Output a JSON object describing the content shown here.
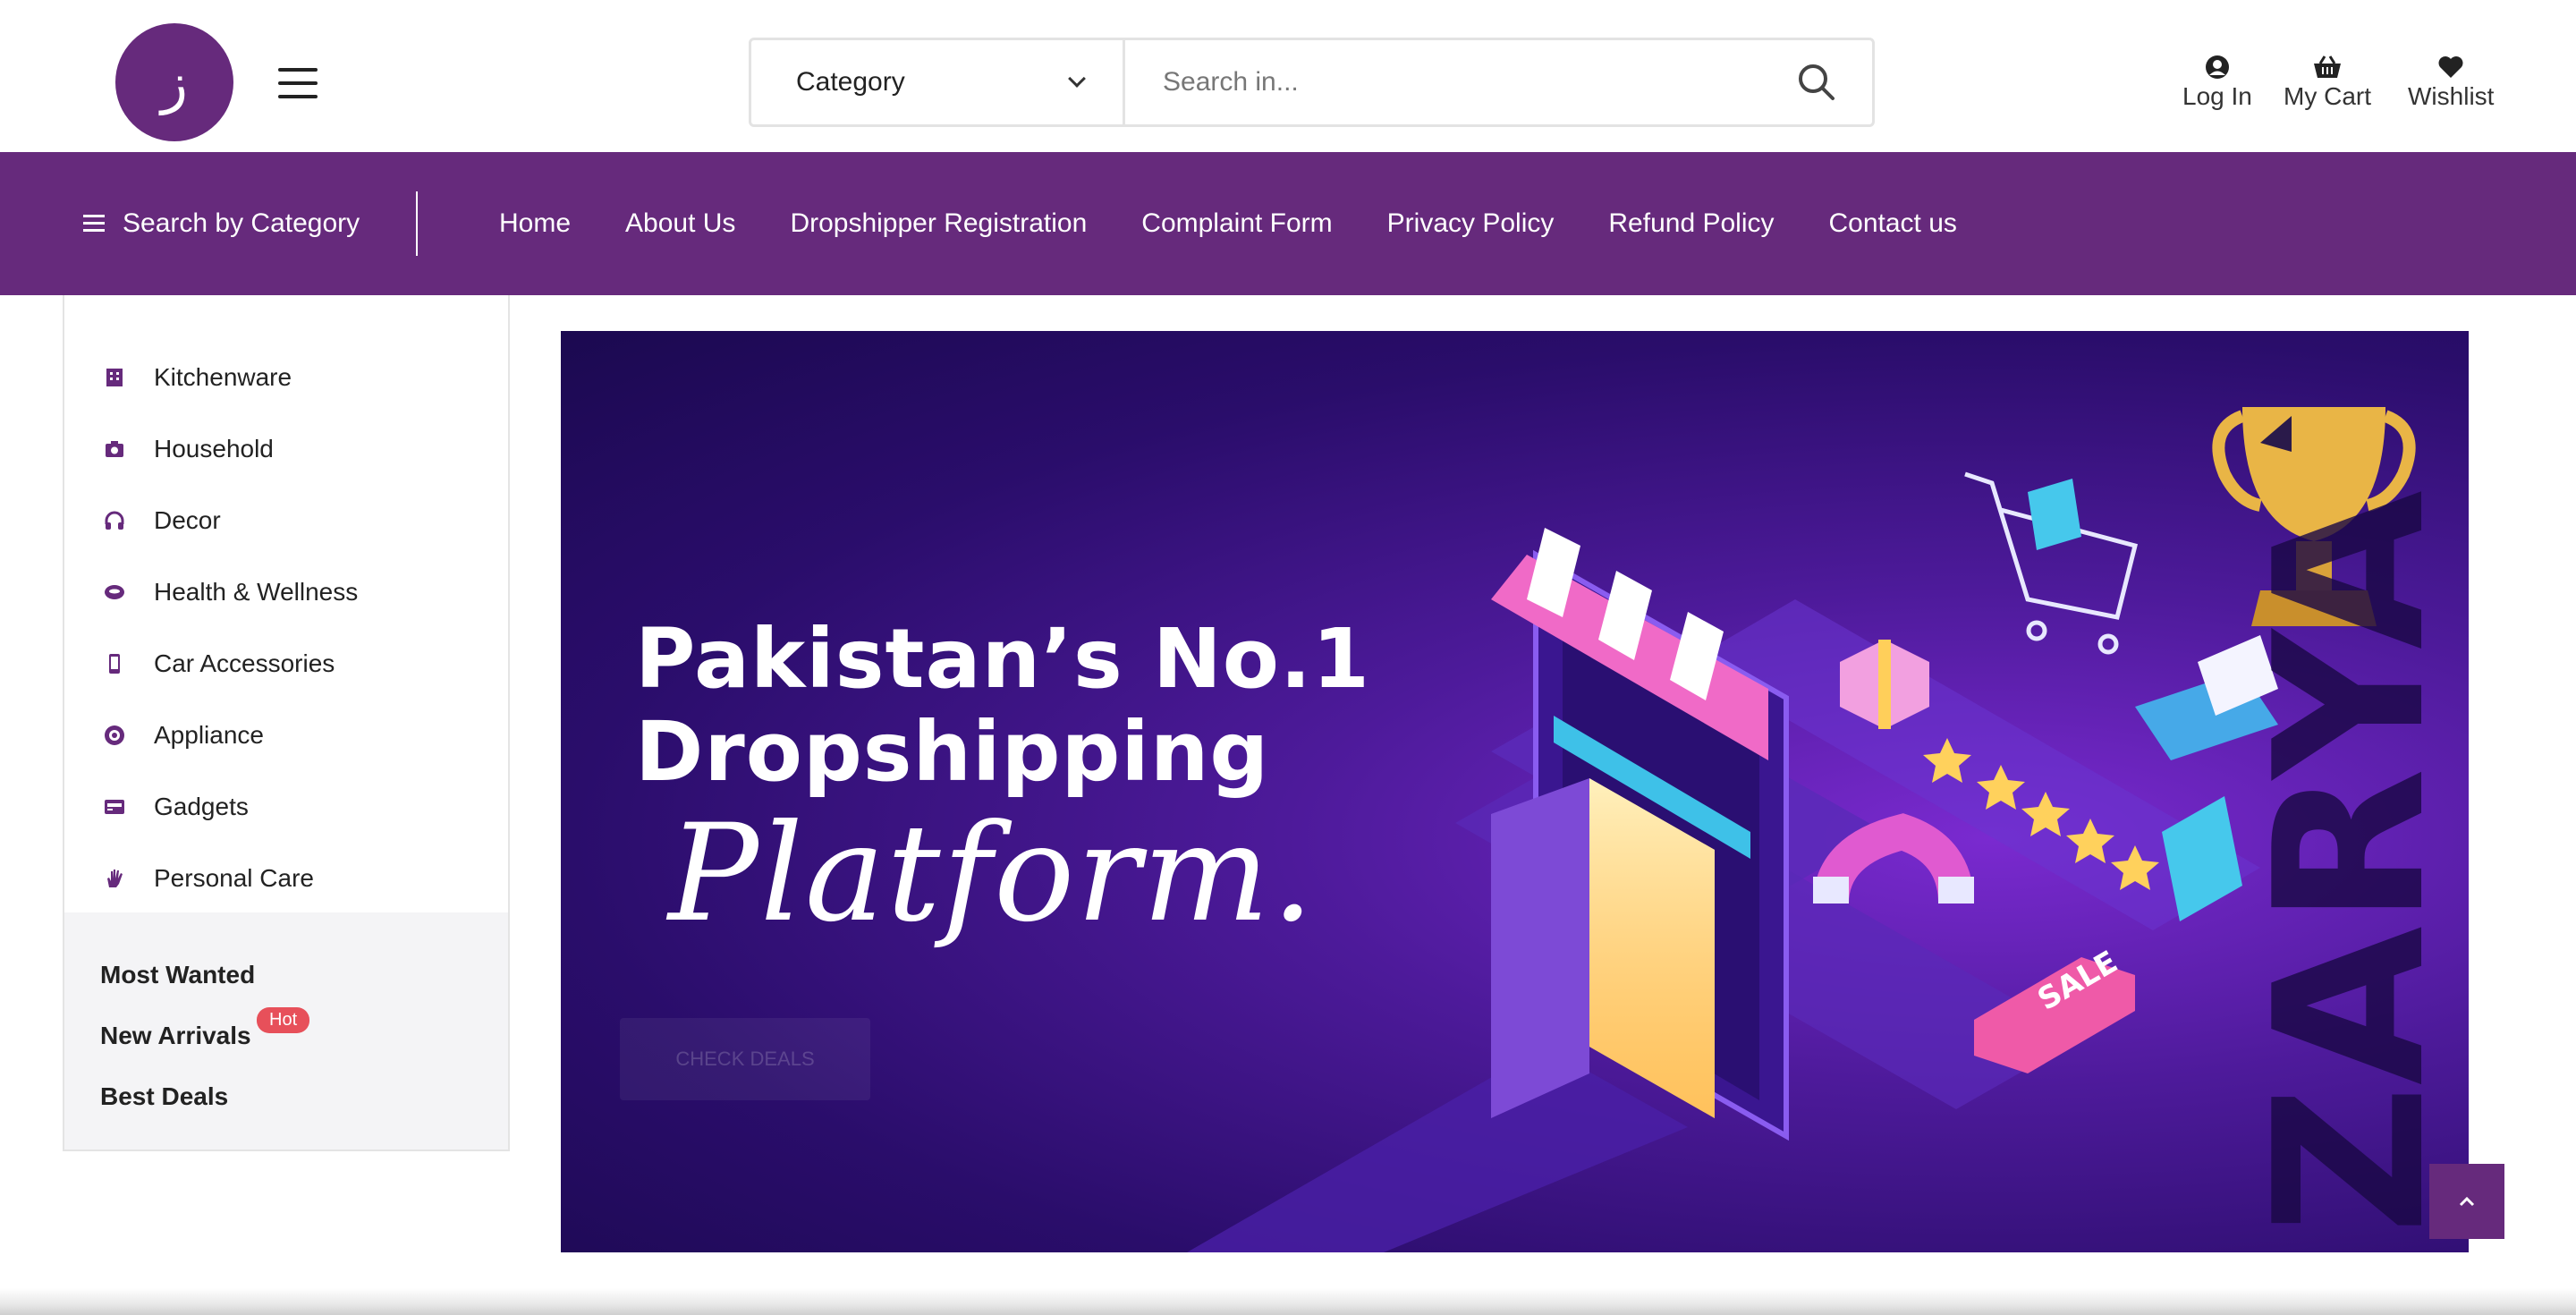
{
  "header": {
    "logo_glyph": "ز",
    "category_select": "Category",
    "search_placeholder": "Search in...",
    "actions": {
      "login": "Log In",
      "cart": "My Cart",
      "wishlist": "Wishlist"
    }
  },
  "nav": {
    "category_toggle": "Search by Category",
    "links": [
      "Home",
      "About Us",
      "Dropshipper Registration",
      "Complaint Form",
      "Privacy Policy",
      "Refund Policy",
      "Contact us"
    ]
  },
  "sidebar": {
    "items": [
      {
        "label": "Kitchenware",
        "icon": "building-icon"
      },
      {
        "label": "Household",
        "icon": "camera-icon"
      },
      {
        "label": "Decor",
        "icon": "headphones-icon"
      },
      {
        "label": "Health & Wellness",
        "icon": "disc-icon"
      },
      {
        "label": "Car Accessories",
        "icon": "mobile-icon"
      },
      {
        "label": "Appliance",
        "icon": "target-icon"
      },
      {
        "label": "Gadgets",
        "icon": "card-icon"
      },
      {
        "label": "Personal Care",
        "icon": "hand-icon"
      }
    ],
    "extra": [
      {
        "label": "Most Wanted"
      },
      {
        "label": "New Arrivals",
        "badge": "Hot"
      },
      {
        "label": "Best Deals"
      }
    ]
  },
  "banner": {
    "headline_line1": "Pakistan’s No.1",
    "headline_line2": "Dropshipping",
    "script_line": "Platform.",
    "cta": "CHECK DEALS",
    "sale_tag": "SALE",
    "brand_vertical": "ZARYA"
  },
  "colors": {
    "brand": "#662a7c",
    "hot_badge": "#e7505a"
  }
}
